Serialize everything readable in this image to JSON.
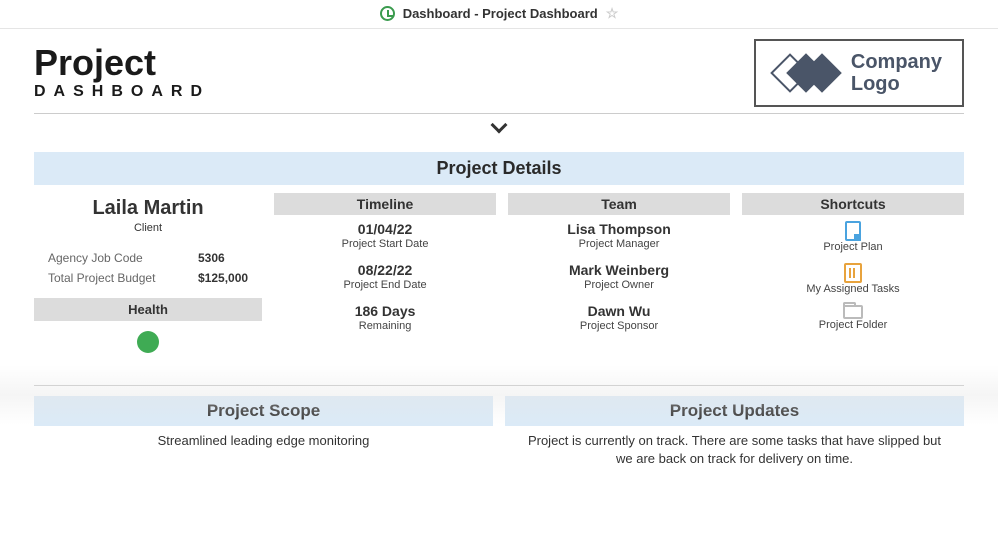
{
  "topbar": {
    "title": "Dashboard - Project Dashboard"
  },
  "header": {
    "title_main": "Project",
    "title_sub": "DASHBOARD",
    "logo_line1": "Company",
    "logo_line2": "Logo"
  },
  "sections": {
    "project_details": "Project Details",
    "timeline": "Timeline",
    "team": "Team",
    "shortcuts": "Shortcuts",
    "health": "Health",
    "scope": "Project Scope",
    "updates": "Project Updates"
  },
  "client": {
    "name": "Laila Martin",
    "role": "Client",
    "agency_job_code_label": "Agency Job Code",
    "agency_job_code": "5306",
    "budget_label": "Total Project Budget",
    "budget": "$125,000",
    "health_color": "#3fab54"
  },
  "timeline": {
    "start": {
      "value": "01/04/22",
      "label": "Project Start Date"
    },
    "end": {
      "value": "08/22/22",
      "label": "Project End Date"
    },
    "remaining": {
      "value": "186 Days",
      "label": "Remaining"
    }
  },
  "team": [
    {
      "name": "Lisa Thompson",
      "role": "Project Manager"
    },
    {
      "name": "Mark Weinberg",
      "role": "Project Owner"
    },
    {
      "name": "Dawn Wu",
      "role": "Project Sponsor"
    }
  ],
  "shortcuts": [
    {
      "label": "Project Plan",
      "icon": "page"
    },
    {
      "label": "My Assigned Tasks",
      "icon": "tasks"
    },
    {
      "label": "Project Folder",
      "icon": "folder"
    }
  ],
  "scope_text": "Streamlined leading edge monitoring",
  "updates_text": "Project is currently on track. There are some tasks that have slipped but we are back on track for delivery on time."
}
